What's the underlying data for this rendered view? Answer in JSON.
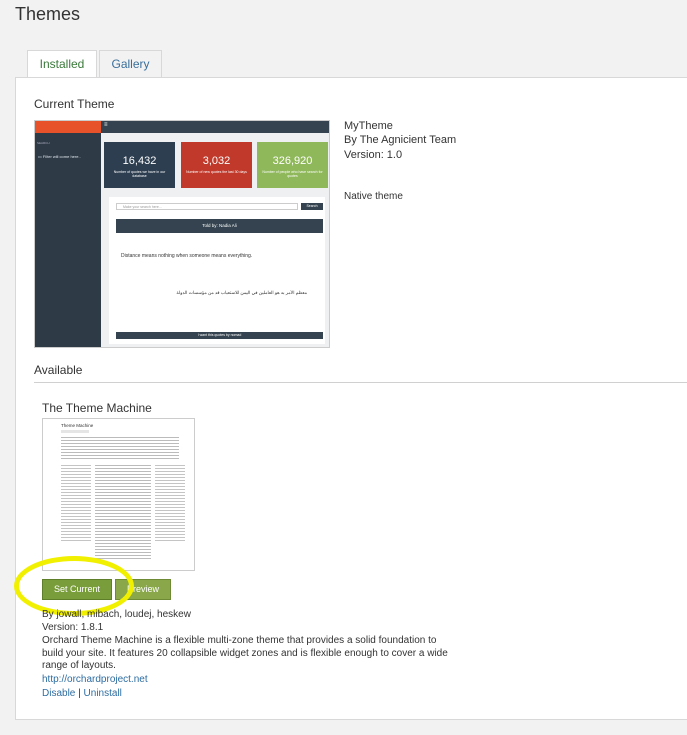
{
  "header": {
    "title": "Themes"
  },
  "tabs": [
    {
      "label": "Installed"
    },
    {
      "label": "Gallery"
    }
  ],
  "current": {
    "heading": "Current Theme",
    "name": "MyTheme",
    "author": "By The Agnicient Team",
    "version": "Version: 1.0",
    "native": "Native theme",
    "preview": {
      "sidebar_search": "SEARCH",
      "filter_note": "Filter will come here..",
      "stats": [
        {
          "label": "16,432",
          "note": "Number of quotes we have in our database",
          "color": "#2c3e50"
        },
        {
          "label": "3,032",
          "note": "Number of new quotes the last 30 days",
          "color": "#c0392b"
        },
        {
          "label": "326,920",
          "note": "Number of people who have search for quotes",
          "color": "#8fb85a"
        }
      ],
      "search_placeholder": "Make your search here...",
      "search_button": "Search",
      "told_by": "Told by: Nadia Ali",
      "quote": "Distance means nothing when someone means everything.",
      "arabic": "معظم الأمر به هو العاملين في اليمن للاستعباب قد من مؤسسات الدولة",
      "more_button": "I want this quotes by nomad"
    }
  },
  "available": {
    "heading": "Available",
    "theme_name": "The Theme Machine",
    "set_current": "Set Current",
    "preview": "Preview",
    "authors": "By jowall, mibach, loudej, heskew",
    "version": "Version: 1.8.1",
    "description_lines": [
      "Orchard Theme Machine is a flexible multi-zone theme that provides a solid foundation to",
      "build your site. It features 20 collapsible widget zones and is flexible enough to cover a wide",
      "range of layouts."
    ],
    "url": "http://orchardproject.net",
    "disable": "Disable",
    "separator": "|",
    "uninstall": "Uninstall",
    "thumbnail": {
      "title": "Theme Machine"
    }
  },
  "colors": {
    "accent_green": "#7a9d3c",
    "link": "#2d6da1",
    "highlight": "#f0f000"
  }
}
